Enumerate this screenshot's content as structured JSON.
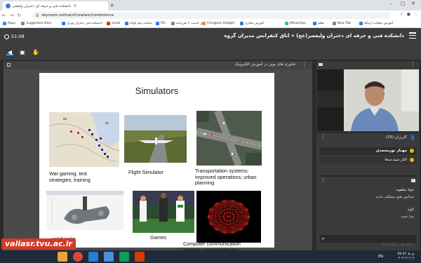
{
  "browser": {
    "tab_active_title": "دانشکده فنی و حرفه ای دختران ولیعصر",
    "url": "skyroom.online/ch/valiasr/conference",
    "bookmarks": [
      "Apps",
      "Suggested Sites",
      "دانشکده فنی دختران تهران",
      "email",
      "سامانه پیام کوتاه",
      "PO..",
      "میز خدمت > هرزنامه",
      "Chargoon Didgah",
      "آموزش مجازی",
      "WhatsApp",
      "معلم",
      "New Tab",
      "آموزش تبلیغات ارتباط"
    ]
  },
  "header": {
    "elapsed_time": "51:08",
    "room_title": "دانشکده فنی و حرفه ای دختران ولیعصر(عج) » اتاق کنفرانس مدیران گروه"
  },
  "presentation": {
    "label": "فناوری های نوین در آموزش الکترونیک",
    "slide": {
      "title": "Simulators",
      "captions": [
        "War gaming: test\nstrategies; training",
        "Flight Simulator",
        "Transportation systems:\nimproved operations; urban\nplanning",
        "solidworks",
        "Games",
        "Computer communication\nnetwork: protocol design"
      ]
    }
  },
  "users": {
    "title": "کاربران (33)",
    "list": [
      "مهناز نورمحمدی",
      "الناز سید سخا"
    ]
  },
  "chat": {
    "messages": [
      {
        "who": "جواد شاهوند",
        "body": "صداتون هیچ مشکلی نداره"
      },
      {
        "who": "کاوه",
        "body": "چرا خوبه"
      }
    ],
    "input_placeholder": "پیام خود را وارد کنید"
  },
  "watermark": "valiasr.tvu.ac.ir",
  "taskbar": {
    "lang": "EN",
    "time": "06:47 ق.ظ",
    "date": "۲۰۲۰/۱۰/۰۷"
  }
}
